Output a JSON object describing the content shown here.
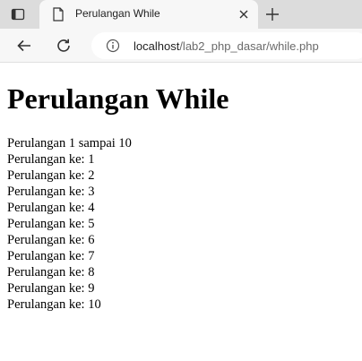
{
  "browser": {
    "tab_title": "Perulangan While",
    "url_host": "localhost",
    "url_path": "/lab2_php_dasar/while.php"
  },
  "page": {
    "heading": "Perulangan While",
    "lines": [
      "Perulangan 1 sampai 10",
      "Perulangan ke: 1",
      "Perulangan ke: 2",
      "Perulangan ke: 3",
      "Perulangan ke: 4",
      "Perulangan ke: 5",
      "Perulangan ke: 6",
      "Perulangan ke: 7",
      "Perulangan ke: 8",
      "Perulangan ke: 9",
      "Perulangan ke: 10"
    ]
  },
  "icons": {
    "tab_actions": "tab-actions-icon",
    "favicon": "document-icon",
    "close": "close-icon",
    "new_tab": "plus-icon",
    "back": "back-arrow-icon",
    "reload": "reload-icon",
    "site_info": "info-icon"
  }
}
